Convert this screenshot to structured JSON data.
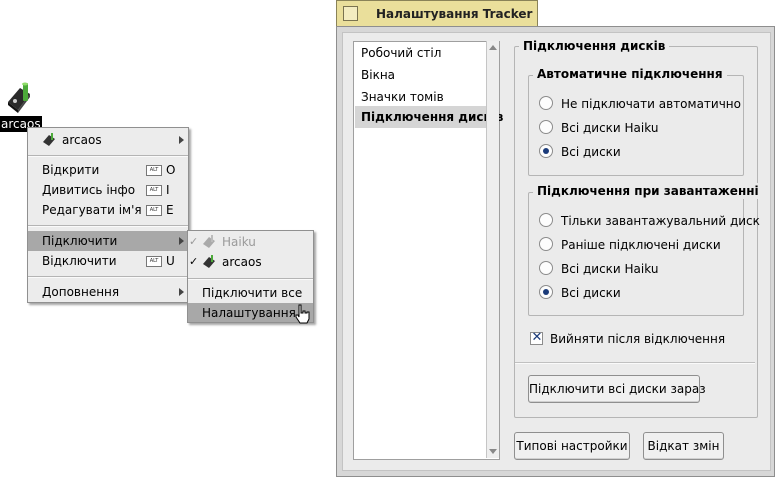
{
  "desktop": {
    "icon_label": "arcaos"
  },
  "context_menu": {
    "header_item": "arcaos",
    "items": [
      {
        "label": "Відкрити",
        "shortcut_mod": "ALT",
        "shortcut_key": "O"
      },
      {
        "label": "Дивитись інфо",
        "shortcut_mod": "ALT",
        "shortcut_key": "I"
      },
      {
        "label": "Редагувати ім'я",
        "shortcut_mod": "ALT",
        "shortcut_key": "E"
      }
    ],
    "mount": "Підключити",
    "unmount": {
      "label": "Відключити",
      "shortcut_mod": "ALT",
      "shortcut_key": "U"
    },
    "addons": "Доповнення"
  },
  "submenu": {
    "volumes": [
      {
        "label": "Haiku",
        "checked": true,
        "disabled": true
      },
      {
        "label": "arcaos",
        "checked": true,
        "disabled": false
      }
    ],
    "mount_all": "Підключити все",
    "settings": "Налаштування..."
  },
  "window": {
    "title": "Налаштування Tracker",
    "sidebar": [
      {
        "label": "Робочий стіл"
      },
      {
        "label": "Вікна"
      },
      {
        "label": "Значки томів"
      },
      {
        "label": "Підключення дисків"
      }
    ],
    "group_title": "Підключення дисків",
    "auto": {
      "title": "Автоматичне підключення",
      "options": [
        "Не підключати автоматично",
        "Всі диски Haiku",
        "Всі диски"
      ],
      "selected": 2
    },
    "boot": {
      "title": "Підключення при завантаженні",
      "options": [
        "Тільки завантажувальний диск",
        "Раніше підключені диски",
        "Всі диски Haiku",
        "Всі диски"
      ],
      "selected": 3
    },
    "eject_checkbox": "Вийняти після відключення",
    "eject_checked": true,
    "mount_all_now": "Підключити всі диски зараз",
    "defaults_button": "Типові настройки",
    "revert_button": "Відкат змін"
  }
}
